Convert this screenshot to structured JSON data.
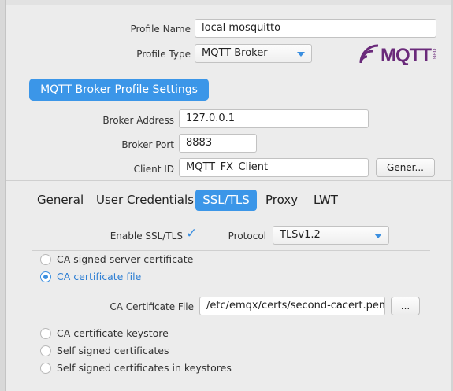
{
  "profile": {
    "name_label": "Profile Name",
    "name_value": "local mosquitto",
    "type_label": "Profile Type",
    "type_value": "MQTT Broker",
    "logo_text": "MQTT",
    "logo_sub": ".ORG"
  },
  "broker": {
    "section_title": "MQTT Broker Profile Settings",
    "address_label": "Broker Address",
    "address_value": "127.0.0.1",
    "port_label": "Broker Port",
    "port_value": "8883",
    "client_id_label": "Client ID",
    "client_id_value": "MQTT_FX_Client",
    "generate_label": "Gener..."
  },
  "tabs": [
    {
      "label": "General",
      "active": false
    },
    {
      "label": "User Credentials",
      "active": false
    },
    {
      "label": "SSL/TLS",
      "active": true
    },
    {
      "label": "Proxy",
      "active": false
    },
    {
      "label": "LWT",
      "active": false
    }
  ],
  "ssl": {
    "enable_label": "Enable SSL/TLS",
    "enabled": true,
    "checkmark": "✓",
    "protocol_label": "Protocol",
    "protocol_value": "TLSv1.2",
    "options": [
      {
        "label": "CA signed server certificate",
        "selected": false
      },
      {
        "label": "CA certificate file",
        "selected": true
      },
      {
        "label": "CA certificate keystore",
        "selected": false
      },
      {
        "label": "Self signed certificates",
        "selected": false
      },
      {
        "label": "Self signed certificates in keystores",
        "selected": false
      }
    ],
    "ca_file_label": "CA Certificate File",
    "ca_file_value": "/etc/emqx/certs/second-cacert.pem",
    "browse_label": "..."
  },
  "colors": {
    "accent": "#3b96e8",
    "background": "#ececec"
  }
}
